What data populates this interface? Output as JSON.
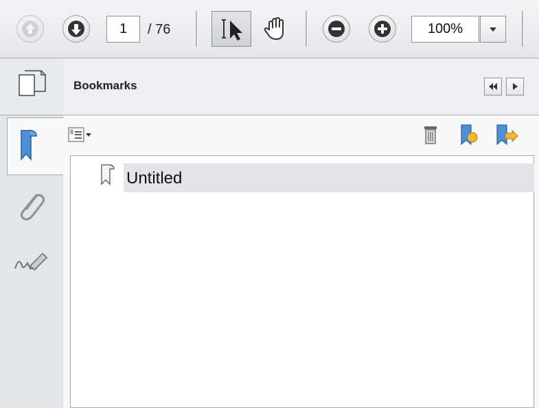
{
  "toolbar": {
    "page_current": "1",
    "page_total": "/ 76",
    "zoom_value": "100%",
    "icons": [
      "prev-page-icon",
      "next-page-icon",
      "select-text-icon",
      "hand-tool-icon",
      "zoom-out-icon",
      "zoom-in-icon",
      "dropdown-arrow-icon"
    ]
  },
  "rail": {
    "icons": [
      "pages-icon",
      "bookmarks-icon",
      "attachments-icon",
      "signatures-icon"
    ]
  },
  "panel": {
    "title": "Bookmarks",
    "icons": [
      "options-menu-icon",
      "delete-bookmark-icon",
      "new-bookmark-icon",
      "expand-bookmark-icon",
      "collapse-panel-icon",
      "expand-panel-icon"
    ]
  },
  "bookmarks": [
    {
      "label": "Untitled"
    }
  ],
  "colors": {
    "toolbar_bg": "#e4e6ea",
    "selection": "#e2e4e7",
    "bookmark_blue": "#4a90d9"
  }
}
